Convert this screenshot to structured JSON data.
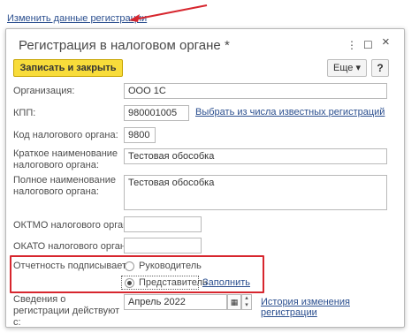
{
  "top_link": "Изменить данные регистрации",
  "window": {
    "title": "Регистрация в налоговом органе *",
    "menu_icon": "⋮",
    "maximize_icon": "☐",
    "close_icon": "×"
  },
  "toolbar": {
    "save_label": "Записать и закрыть",
    "more_label": "Еще ▾",
    "help_label": "?"
  },
  "fields": {
    "org_label": "Организация:",
    "org_value": "ООО 1С",
    "kpp_label": "КПП:",
    "kpp_value": "980001005",
    "kpp_link": "Выбрать из числа известных регистраций",
    "code_label": "Код налогового органа:",
    "code_value": "9800",
    "short_label": "Краткое наименование налогового органа:",
    "short_value": "Тестовая обособка",
    "full_label": "Полное наименование налогового органа:",
    "full_value": "Тестовая обособка",
    "oktmo_label": "ОКТМО налогового органа:",
    "oktmo_value": "",
    "okato_label": "ОКАТО налогового органа:",
    "okato_value": ""
  },
  "signer": {
    "label": "Отчетность подписывает:",
    "option_director": "Руководитель",
    "option_representative": "Представитель",
    "fill_link": "Заполнить",
    "selected": "Представитель"
  },
  "registration": {
    "label": "Сведения о регистрации действуют с:",
    "value": "Апрель 2022",
    "history_link": "История изменения регистрации"
  }
}
